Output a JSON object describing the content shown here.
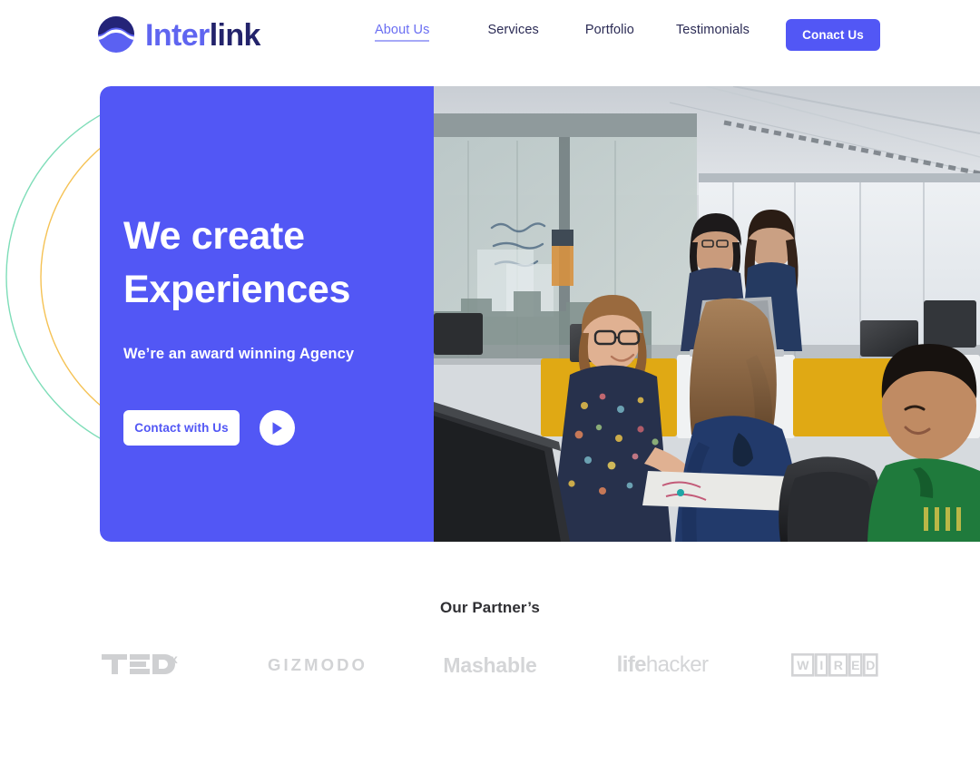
{
  "brand": {
    "name_part1": "Inter",
    "name_part2": "link",
    "logo_icon": "interlink-wave-circle-logo",
    "color_primary": "#5257f5",
    "color_dark": "#23236b"
  },
  "nav": {
    "items": [
      {
        "label": "About Us",
        "active": true
      },
      {
        "label": "Services",
        "active": false
      },
      {
        "label": "Portfolio",
        "active": false
      },
      {
        "label": "Testimonials",
        "active": false
      }
    ],
    "cta_label": "Conact Us"
  },
  "hero": {
    "title": "We create\nExperiences",
    "subtitle": "We’re an award winning Agency",
    "button_label": "Contact with Us",
    "play_icon": "play-triangle-icon",
    "panel_color": "#5257f5",
    "photo_alt": "Office team collaborating at desks",
    "decorations": {
      "arc_outer_color": "#7eddb8",
      "arc_inner_color": "#f5c254"
    }
  },
  "partners": {
    "title": "Our Partner’s",
    "logos": [
      {
        "name": "TEDx",
        "icon": "tedx-logo"
      },
      {
        "name": "GIZMODO",
        "icon": "gizmodo-logo"
      },
      {
        "name": "Mashable",
        "icon": "mashable-logo"
      },
      {
        "name": "lifehacker",
        "icon": "lifehacker-logo",
        "bold_part": "life",
        "light_part": "hacker"
      },
      {
        "name": "WIRED",
        "icon": "wired-logo",
        "letters": [
          "W",
          "I",
          "R",
          "E",
          "D"
        ]
      }
    ],
    "logo_color": "#d2d3d5"
  }
}
